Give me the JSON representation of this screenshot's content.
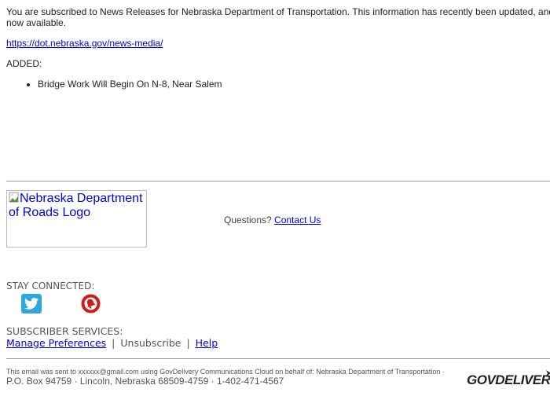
{
  "intro": {
    "text": "You are subscribed to News Releases for Nebraska Department of Transportation. This information has recently been updated, and is now available."
  },
  "link": {
    "text": "https://dot.nebraska.gov/news-media/"
  },
  "added": {
    "label": "ADDED:",
    "items": [
      "Bridge Work Will Begin On N-8, Near Salem"
    ]
  },
  "logo": {
    "alt": "Nebraska Department of Roads Logo"
  },
  "questions": {
    "label": "Questions?",
    "contact": "Contact Us"
  },
  "social": {
    "title": "STAY CONNECTED:",
    "icons": [
      "twitter-icon",
      "alert-bell-icon"
    ],
    "twitter_color": "#2ca7e0",
    "bell_color": "#d11c1c"
  },
  "subscriber": {
    "title": "SUBSCRIBER SERVICES:",
    "manage": "Manage Preferences",
    "sep": "|",
    "unsubscribe": "Unsubscribe",
    "help": "Help"
  },
  "footer": {
    "small1": "This email was sent to xxxxxx@gmail.com using GovDelivery Communications Cloud on behalf of: Nebraska Department of Transportation",
    "dot": " · ",
    "address": "P.O. Box 94759 · Lincoln, Nebraska 68509-4759 · 1-402-471-4567",
    "brand": "GOVDELIVERY"
  }
}
